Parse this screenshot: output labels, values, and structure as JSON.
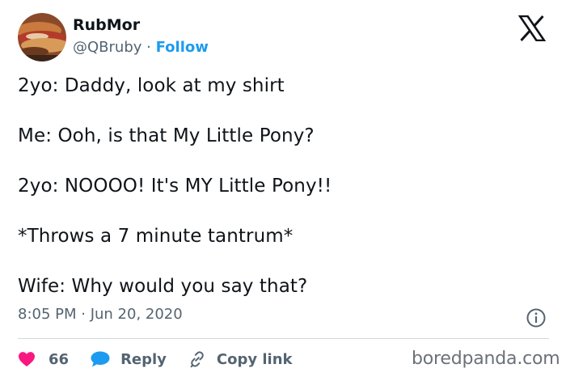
{
  "author": {
    "name": "RubMor",
    "handle": "@QBruby",
    "separator": "·",
    "follow_label": "Follow"
  },
  "tweet": {
    "lines": [
      "2yo: Daddy, look at my shirt",
      "Me: Ooh, is that My Little Pony?",
      "2yo: NOOOO! It's MY Little Pony!!",
      "*Throws a 7 minute tantrum*",
      "Wife: Why would you say that?"
    ],
    "timestamp": "8:05 PM · Jun 20, 2020"
  },
  "actions": {
    "like_count": "66",
    "reply_label": "Reply",
    "copy_link_label": "Copy link"
  },
  "watermark": "boredpanda.com",
  "colors": {
    "like": "#f91880",
    "reply": "#1d9bf0",
    "follow": "#1d9bf0",
    "muted": "#536471",
    "text": "#0f1419"
  },
  "icons": {
    "brand": "x-logo-icon",
    "info": "info-icon",
    "like": "heart-icon",
    "reply": "speech-bubble-icon",
    "copy_link": "link-icon"
  }
}
